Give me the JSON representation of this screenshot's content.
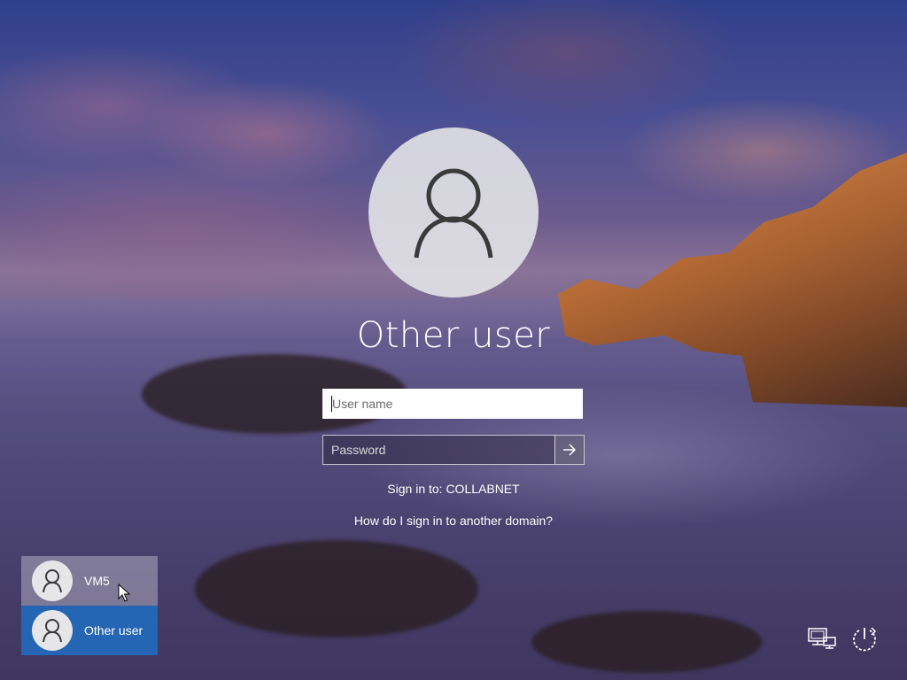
{
  "login": {
    "title": "Other user",
    "username_placeholder": "User name",
    "password_placeholder": "Password",
    "sign_in_to": "Sign in to: COLLABNET",
    "other_domain_link": "How do I sign in to another domain?"
  },
  "user_switcher": {
    "items": [
      {
        "label": "VM5",
        "selected": false
      },
      {
        "label": "Other user",
        "selected": true
      }
    ]
  },
  "icons": {
    "avatar": "user-silhouette-icon",
    "submit": "arrow-right-icon",
    "network": "network-icon",
    "power": "power-icon"
  },
  "colors": {
    "selected_tile": "#2566b4",
    "text": "#ffffff"
  }
}
